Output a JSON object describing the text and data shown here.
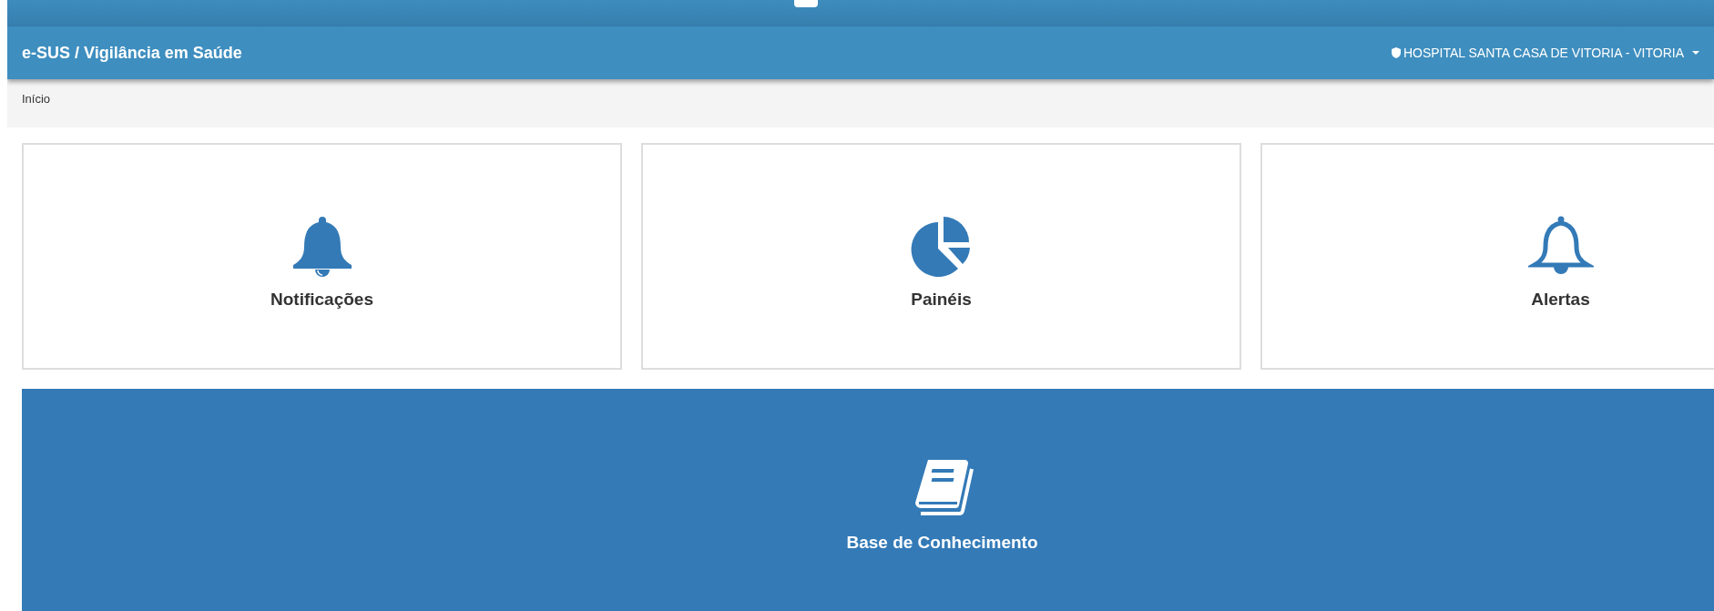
{
  "navbar": {
    "title": "e-SUS / Vigilância em Saúde",
    "organization": "HOSPITAL SANTA CASA DE VITORIA - VITORIA"
  },
  "breadcrumb": [
    "Início"
  ],
  "tiles": [
    {
      "label": "Notificações",
      "kind": "bell"
    },
    {
      "label": "Painéis",
      "kind": "pie"
    },
    {
      "label": "Alertas",
      "kind": "bell-outline"
    }
  ],
  "featured_tile": {
    "label": "Base de Conhecimento",
    "kind": "book"
  }
}
